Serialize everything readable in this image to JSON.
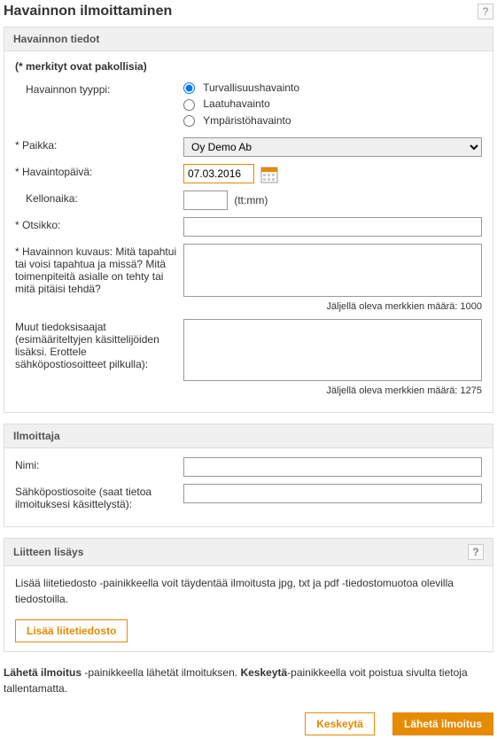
{
  "page": {
    "title": "Havainnon ilmoittaminen",
    "help_symbol": "?"
  },
  "section1": {
    "title": "Havainnon tiedot",
    "mandatory_note": "(* merkityt ovat pakollisia)",
    "type_label": "Havainnon tyyppi:",
    "type_options": {
      "opt1": "Turvallisuushavainto",
      "opt2": "Laatuhavainto",
      "opt3": "Ympäristöhavainto"
    },
    "location_label": "*  Paikka:",
    "location_value": "Oy Demo Ab",
    "date_label": "*  Havaintopäivä:",
    "date_value": "07.03.2016",
    "time_label": "Kellonaika:",
    "time_hint": "(tt:mm)",
    "title_field_label": "*  Otsikko:",
    "description_label": "*  Havainnon kuvaus: Mitä tapahtui tai voisi tapahtua ja missä? Mitä toimenpiteitä asialle on tehty tai mitä pitäisi tehdä?",
    "description_chars": "Jäljellä oleva merkkien määrä: 1000",
    "recipients_label": "Muut tiedoksisaajat (esimääriteltyjen käsittelijöiden lisäksi. Erottele sähköpostiosoitteet pilkulla):",
    "recipients_chars": "Jäljellä oleva merkkien määrä: 1275"
  },
  "section2": {
    "title": "Ilmoittaja",
    "name_label": "Nimi:",
    "email_label": "Sähköpostiosoite (saat tietoa ilmoituksesi käsittelystä):"
  },
  "section3": {
    "title": "Liitteen lisäys",
    "help_symbol": "?",
    "attach_help": "Lisää liitetiedosto -painikkeella voit täydentää ilmoitusta jpg, txt ja pdf -tiedostomuotoa olevilla tiedostoilla.",
    "attach_button": "Lisää liitetiedosto"
  },
  "bottom": {
    "text_prefix": "Lähetä ilmoitus",
    "text_mid1": " -painikkeella lähetät ilmoituksen. ",
    "text_bold2": "Keskeytä",
    "text_mid2": "-painikkeella voit poistua sivulta tietoja tallentamatta.",
    "cancel_button": "Keskeytä",
    "submit_button": "Lähetä ilmoitus"
  }
}
